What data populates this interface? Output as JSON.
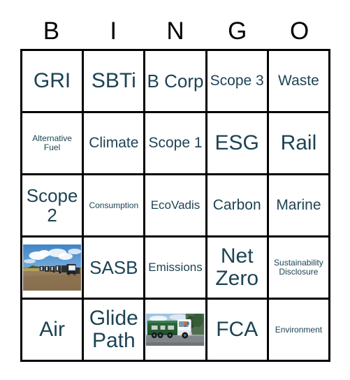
{
  "header": {
    "letters": [
      "B",
      "I",
      "N",
      "G",
      "O"
    ]
  },
  "colors": {
    "cell_text": "#1d4353",
    "header_text": "#000000",
    "grid_line": "#000000",
    "cell_background": "#ffffff"
  },
  "grid": {
    "rows": [
      [
        {
          "type": "text",
          "label": "GRI",
          "size": "xl"
        },
        {
          "type": "text",
          "label": "SBTi",
          "size": "xl"
        },
        {
          "type": "text",
          "label": "B Corp",
          "size": "lg"
        },
        {
          "type": "text",
          "label": "Scope 3",
          "size": "md"
        },
        {
          "type": "text",
          "label": "Waste",
          "size": "md"
        }
      ],
      [
        {
          "type": "text",
          "label": "Alternative Fuel",
          "size": "xs"
        },
        {
          "type": "text",
          "label": "Climate",
          "size": "md"
        },
        {
          "type": "text",
          "label": "Scope 1",
          "size": "md"
        },
        {
          "type": "text",
          "label": "ESG",
          "size": "xl"
        },
        {
          "type": "text",
          "label": "Rail",
          "size": "xl"
        }
      ],
      [
        {
          "type": "text",
          "label": "Scope 2",
          "size": "lg"
        },
        {
          "type": "text",
          "label": "Consumption",
          "size": "xs"
        },
        {
          "type": "text",
          "label": "EcoVadis",
          "size": "sm"
        },
        {
          "type": "text",
          "label": "Carbon",
          "size": "md"
        },
        {
          "type": "text",
          "label": "Marine",
          "size": "md"
        }
      ],
      [
        {
          "type": "photo",
          "label": "truck-fleet-dirt-lot-photo",
          "variant": "fleet"
        },
        {
          "type": "text",
          "label": "SASB",
          "size": "lg"
        },
        {
          "type": "text",
          "label": "Emissions",
          "size": "sm"
        },
        {
          "type": "text",
          "label": "Net Zero",
          "size": "xl"
        },
        {
          "type": "text",
          "label": "Sustainability Disclosure",
          "size": "xs"
        }
      ],
      [
        {
          "type": "text",
          "label": "Air",
          "size": "xl"
        },
        {
          "type": "text",
          "label": "Glide Path",
          "size": "xl"
        },
        {
          "type": "photo",
          "label": "green-semi-truck-on-road-photo",
          "variant": "semi"
        },
        {
          "type": "text",
          "label": "FCA",
          "size": "xl"
        },
        {
          "type": "text",
          "label": "Environment",
          "size": "xs"
        }
      ]
    ]
  }
}
